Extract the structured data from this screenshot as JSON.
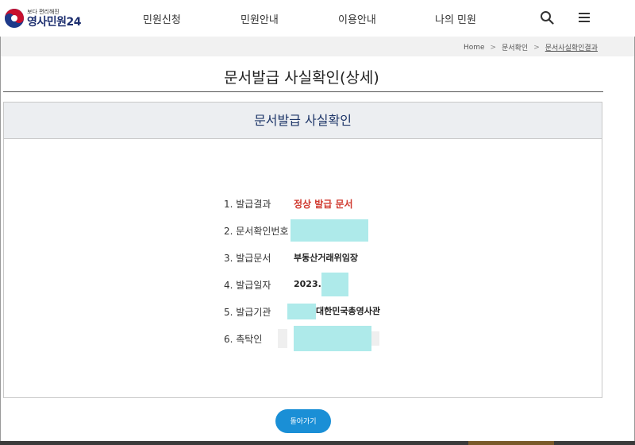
{
  "header": {
    "logo_sub": "보다 편리해진",
    "logo_main": "영사민원24",
    "nav": [
      {
        "label": "민원신청"
      },
      {
        "label": "민원안내"
      },
      {
        "label": "이용안내"
      },
      {
        "label": "나의 민원"
      }
    ]
  },
  "breadcrumb": {
    "items": [
      "Home",
      "문서확인",
      "문서사실확인결과"
    ]
  },
  "page_title": "문서발급 사실확인(상세)",
  "panel": {
    "title": "문서발급 사실확인",
    "rows": [
      {
        "label": "1. 발급결과",
        "value": "정상 발급 문서"
      },
      {
        "label": "2. 문서확인번호",
        "value": ""
      },
      {
        "label": "3. 발급문서",
        "value": "부동산거래위임장"
      },
      {
        "label": "4. 발급일자",
        "value": "2023."
      },
      {
        "label": "5. 발급기관",
        "value": "대한민국총영사관"
      },
      {
        "label": "6. 촉탁인",
        "value": ""
      }
    ]
  },
  "back_button": "돌아가기",
  "colors": {
    "accent": "#1a8fd6",
    "result_red": "#d03a2f",
    "navy": "#1d3568",
    "redaction": "#aeeaea"
  }
}
